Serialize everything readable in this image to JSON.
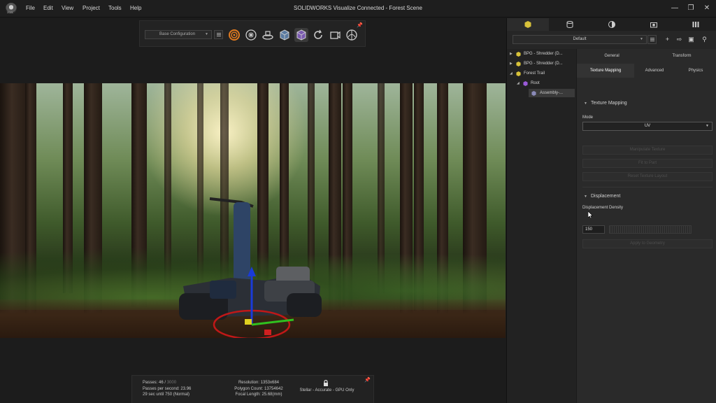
{
  "app": {
    "title": "SOLIDWORKS Visualize Connected - Forest Scene",
    "logo_year": "2021",
    "menu": [
      "File",
      "Edit",
      "View",
      "Project",
      "Tools",
      "Help"
    ]
  },
  "toolbar": {
    "configuration": "Base Configuration",
    "tools": [
      "render-mode-icon",
      "ai-denoiser-icon",
      "turntable-icon",
      "model-icon",
      "part-icon",
      "refresh-icon",
      "camera-icon",
      "environment-icon"
    ]
  },
  "stats": {
    "passes": "Passes: 46 /",
    "passes_total": "3000",
    "passes_per_second": "Passes per second: 23.96",
    "time_until": "29 sec until 750 (Normal)",
    "resolution": "Resolution: 1353x684",
    "polygon_count": "Polygon Count: 13754642",
    "focal_length": "Focal Length: 25.68(mm)",
    "render_mode": "Stellar - Accurate - GPU Only"
  },
  "panel": {
    "tabs": [
      "models-tab-icon",
      "appearances-tab-icon",
      "scenes-tab-icon",
      "cameras-tab-icon",
      "libraries-tab-icon"
    ],
    "preset": "Default",
    "tree": [
      {
        "label": "BPG - Shredder (D...",
        "level": 0,
        "expanded": false
      },
      {
        "label": "BPG - Shredder (D...",
        "level": 0,
        "expanded": false
      },
      {
        "label": "Forest Trail",
        "level": 0,
        "expanded": true
      },
      {
        "label": "Root",
        "level": 1,
        "expanded": true
      },
      {
        "label": "Assembly-...",
        "level": 2,
        "expanded": false
      }
    ],
    "subtabs_row1": [
      "General",
      "Transform"
    ],
    "subtabs_row2": [
      "Texture Mapping",
      "Advanced",
      "Physics"
    ],
    "texture_mapping": {
      "section_title": "Texture Mapping",
      "mode_label": "Mode",
      "mode_value": "UV",
      "buttons": [
        "Manipulate Texture",
        "Fit to Part",
        "Reset Texture Layout"
      ]
    },
    "displacement": {
      "section_title": "Displacement",
      "density_label": "Displacement Density",
      "density_value": "150",
      "apply_button": "Apply to Geometry"
    }
  },
  "colors": {
    "accent_orange": "#e07a20",
    "cube_yellow": "#d8c23a",
    "cube_purple": "#9a5ad8"
  }
}
